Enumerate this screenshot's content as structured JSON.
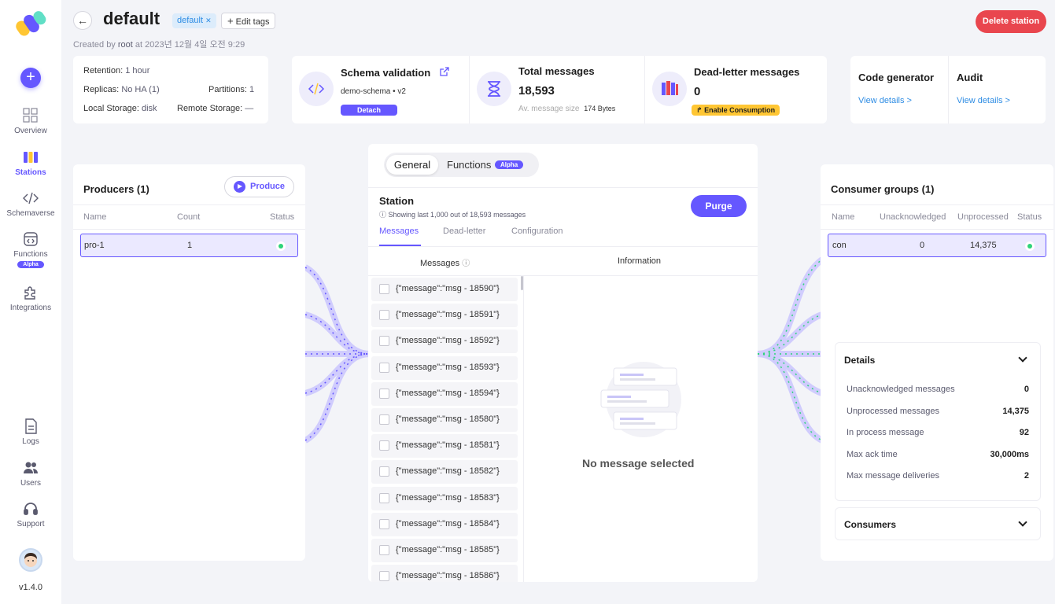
{
  "sidebar": {
    "items": [
      {
        "label": "Overview",
        "icon": "grid-icon"
      },
      {
        "label": "Stations",
        "icon": "stations-icon"
      },
      {
        "label": "Schemaverse",
        "icon": "code-icon"
      },
      {
        "label": "Functions",
        "icon": "functions-icon",
        "badge": "Alpha"
      },
      {
        "label": "Integrations",
        "icon": "puzzle-icon"
      },
      {
        "label": "Logs",
        "icon": "document-icon"
      },
      {
        "label": "Users",
        "icon": "users-icon"
      },
      {
        "label": "Support",
        "icon": "headset-icon"
      }
    ],
    "version": "v1.4.0"
  },
  "header": {
    "title": "default",
    "tag": "default",
    "edit_tags": "Edit tags",
    "created_prefix": "Created by",
    "created_user": "root",
    "created_suffix": "at 2023년 12월 4일 오전 9:29",
    "delete_label": "Delete station"
  },
  "info": {
    "retention_label": "Retention:",
    "retention_value": "1 hour",
    "replicas_label": "Replicas:",
    "replicas_value": "No HA (1)",
    "partitions_label": "Partitions:",
    "partitions_value": "1",
    "local_label": "Local Storage:",
    "local_value": "disk",
    "remote_label": "Remote Storage:",
    "remote_value": "—"
  },
  "stats": {
    "schema_title": "Schema validation",
    "schema_name": "demo-schema",
    "schema_version": "v2",
    "detach_label": "Detach",
    "total_title": "Total messages",
    "total_value": "18,593",
    "avg_label": "Av. message size",
    "avg_value": "174 Bytes",
    "dead_title": "Dead-letter messages",
    "dead_value": "0",
    "enable_label": "Enable Consumption"
  },
  "tools": {
    "code_title": "Code generator",
    "code_link": "View details >",
    "audit_title": "Audit",
    "audit_link": "View details >"
  },
  "producers": {
    "title": "Producers (1)",
    "produce_label": "Produce",
    "columns": [
      "Name",
      "Count",
      "Status"
    ],
    "rows": [
      {
        "name": "pro-1",
        "count": "1",
        "status": "online"
      }
    ]
  },
  "center": {
    "tab_general": "General",
    "tab_functions": "Functions",
    "tab_alpha": "Alpha",
    "station_label": "Station",
    "station_sub": "Showing last 1,000 out of 18,593 messages",
    "purge_label": "Purge",
    "subtabs": [
      "Messages",
      "Dead-letter",
      "Configuration"
    ],
    "messages_head": "Messages",
    "info_head": "Information",
    "messages": [
      "{\"message\":\"msg - 18590\"}",
      "{\"message\":\"msg - 18591\"}",
      "{\"message\":\"msg - 18592\"}",
      "{\"message\":\"msg - 18593\"}",
      "{\"message\":\"msg - 18594\"}",
      "{\"message\":\"msg - 18580\"}",
      "{\"message\":\"msg - 18581\"}",
      "{\"message\":\"msg - 18582\"}",
      "{\"message\":\"msg - 18583\"}",
      "{\"message\":\"msg - 18584\"}",
      "{\"message\":\"msg - 18585\"}",
      "{\"message\":\"msg - 18586\"}"
    ],
    "no_message": "No message selected"
  },
  "consumers": {
    "title": "Consumer groups (1)",
    "columns": [
      "Name",
      "Unacknowledged",
      "Unprocessed",
      "Status"
    ],
    "rows": [
      {
        "name": "con",
        "unack": "0",
        "unprocessed": "14,375",
        "status": "online"
      }
    ],
    "details_title": "Details",
    "details": [
      {
        "label": "Unacknowledged messages",
        "value": "0"
      },
      {
        "label": "Unprocessed messages",
        "value": "14,375"
      },
      {
        "label": "In process message",
        "value": "92"
      },
      {
        "label": "Max ack time",
        "value": "30,000ms"
      },
      {
        "label": "Max message deliveries",
        "value": "2"
      }
    ],
    "consumers_title": "Consumers"
  },
  "colors": {
    "accent": "#6557ff",
    "danger": "#e9464e",
    "warning": "#ffc633",
    "online": "#2ed47a",
    "link": "#2f8de4"
  }
}
